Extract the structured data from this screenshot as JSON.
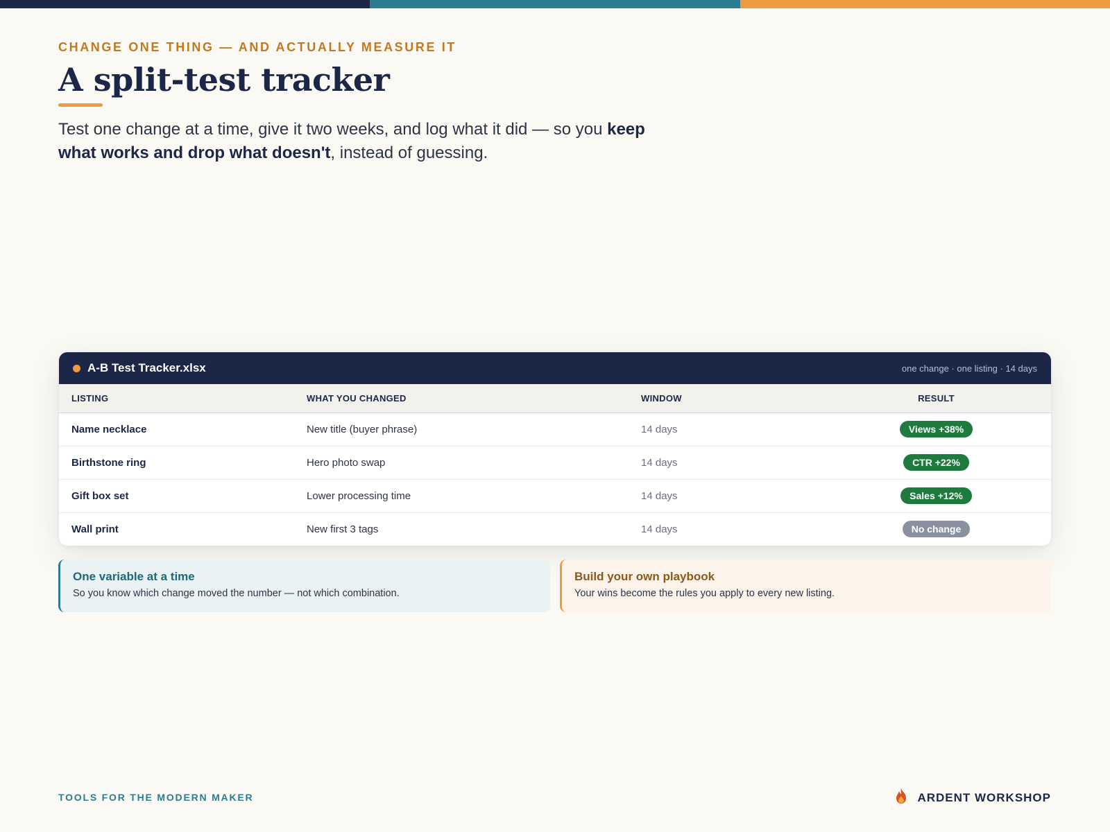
{
  "colors": {
    "navy": "#1c2747",
    "teal": "#2b7d8f",
    "orange": "#ec9b43",
    "green": "#1f7a3e",
    "gray": "#8a90a0"
  },
  "header": {
    "eyebrow": "CHANGE ONE THING — AND ACTUALLY MEASURE IT",
    "title": "A split-test tracker",
    "lede_start": "Test one change at a time, give it two weeks, and log what it did — so you ",
    "lede_bold": "keep what works and drop what doesn't",
    "lede_end": ", instead of guessing."
  },
  "tracker": {
    "file_name": "A-B Test Tracker.xlsx",
    "meta": "one change · one listing · 14 days",
    "columns": [
      "LISTING",
      "WHAT YOU CHANGED",
      "WINDOW",
      "RESULT"
    ],
    "rows": [
      {
        "listing": "Name necklace",
        "change": "New title (buyer phrase)",
        "window": "14 days",
        "result": "Views +38%",
        "result_color": "#1f7a3e"
      },
      {
        "listing": "Birthstone ring",
        "change": "Hero photo swap",
        "window": "14 days",
        "result": "CTR +22%",
        "result_color": "#1f7a3e"
      },
      {
        "listing": "Gift box set",
        "change": "Lower processing time",
        "window": "14 days",
        "result": "Sales +12%",
        "result_color": "#1f7a3e"
      },
      {
        "listing": "Wall print",
        "change": "New first 3 tags",
        "window": "14 days",
        "result": "No change",
        "result_color": "#8a90a0"
      }
    ]
  },
  "notes": [
    {
      "title": "One variable at a time",
      "body": "So you know which change moved the number — not which combination."
    },
    {
      "title": "Build your own playbook",
      "body": "Your wins become the rules you apply to every new listing."
    }
  ],
  "footer": {
    "tagline": "TOOLS FOR THE MODERN MAKER",
    "brand": "ARDENT WORKSHOP",
    "brand_icon": "flame-icon"
  }
}
